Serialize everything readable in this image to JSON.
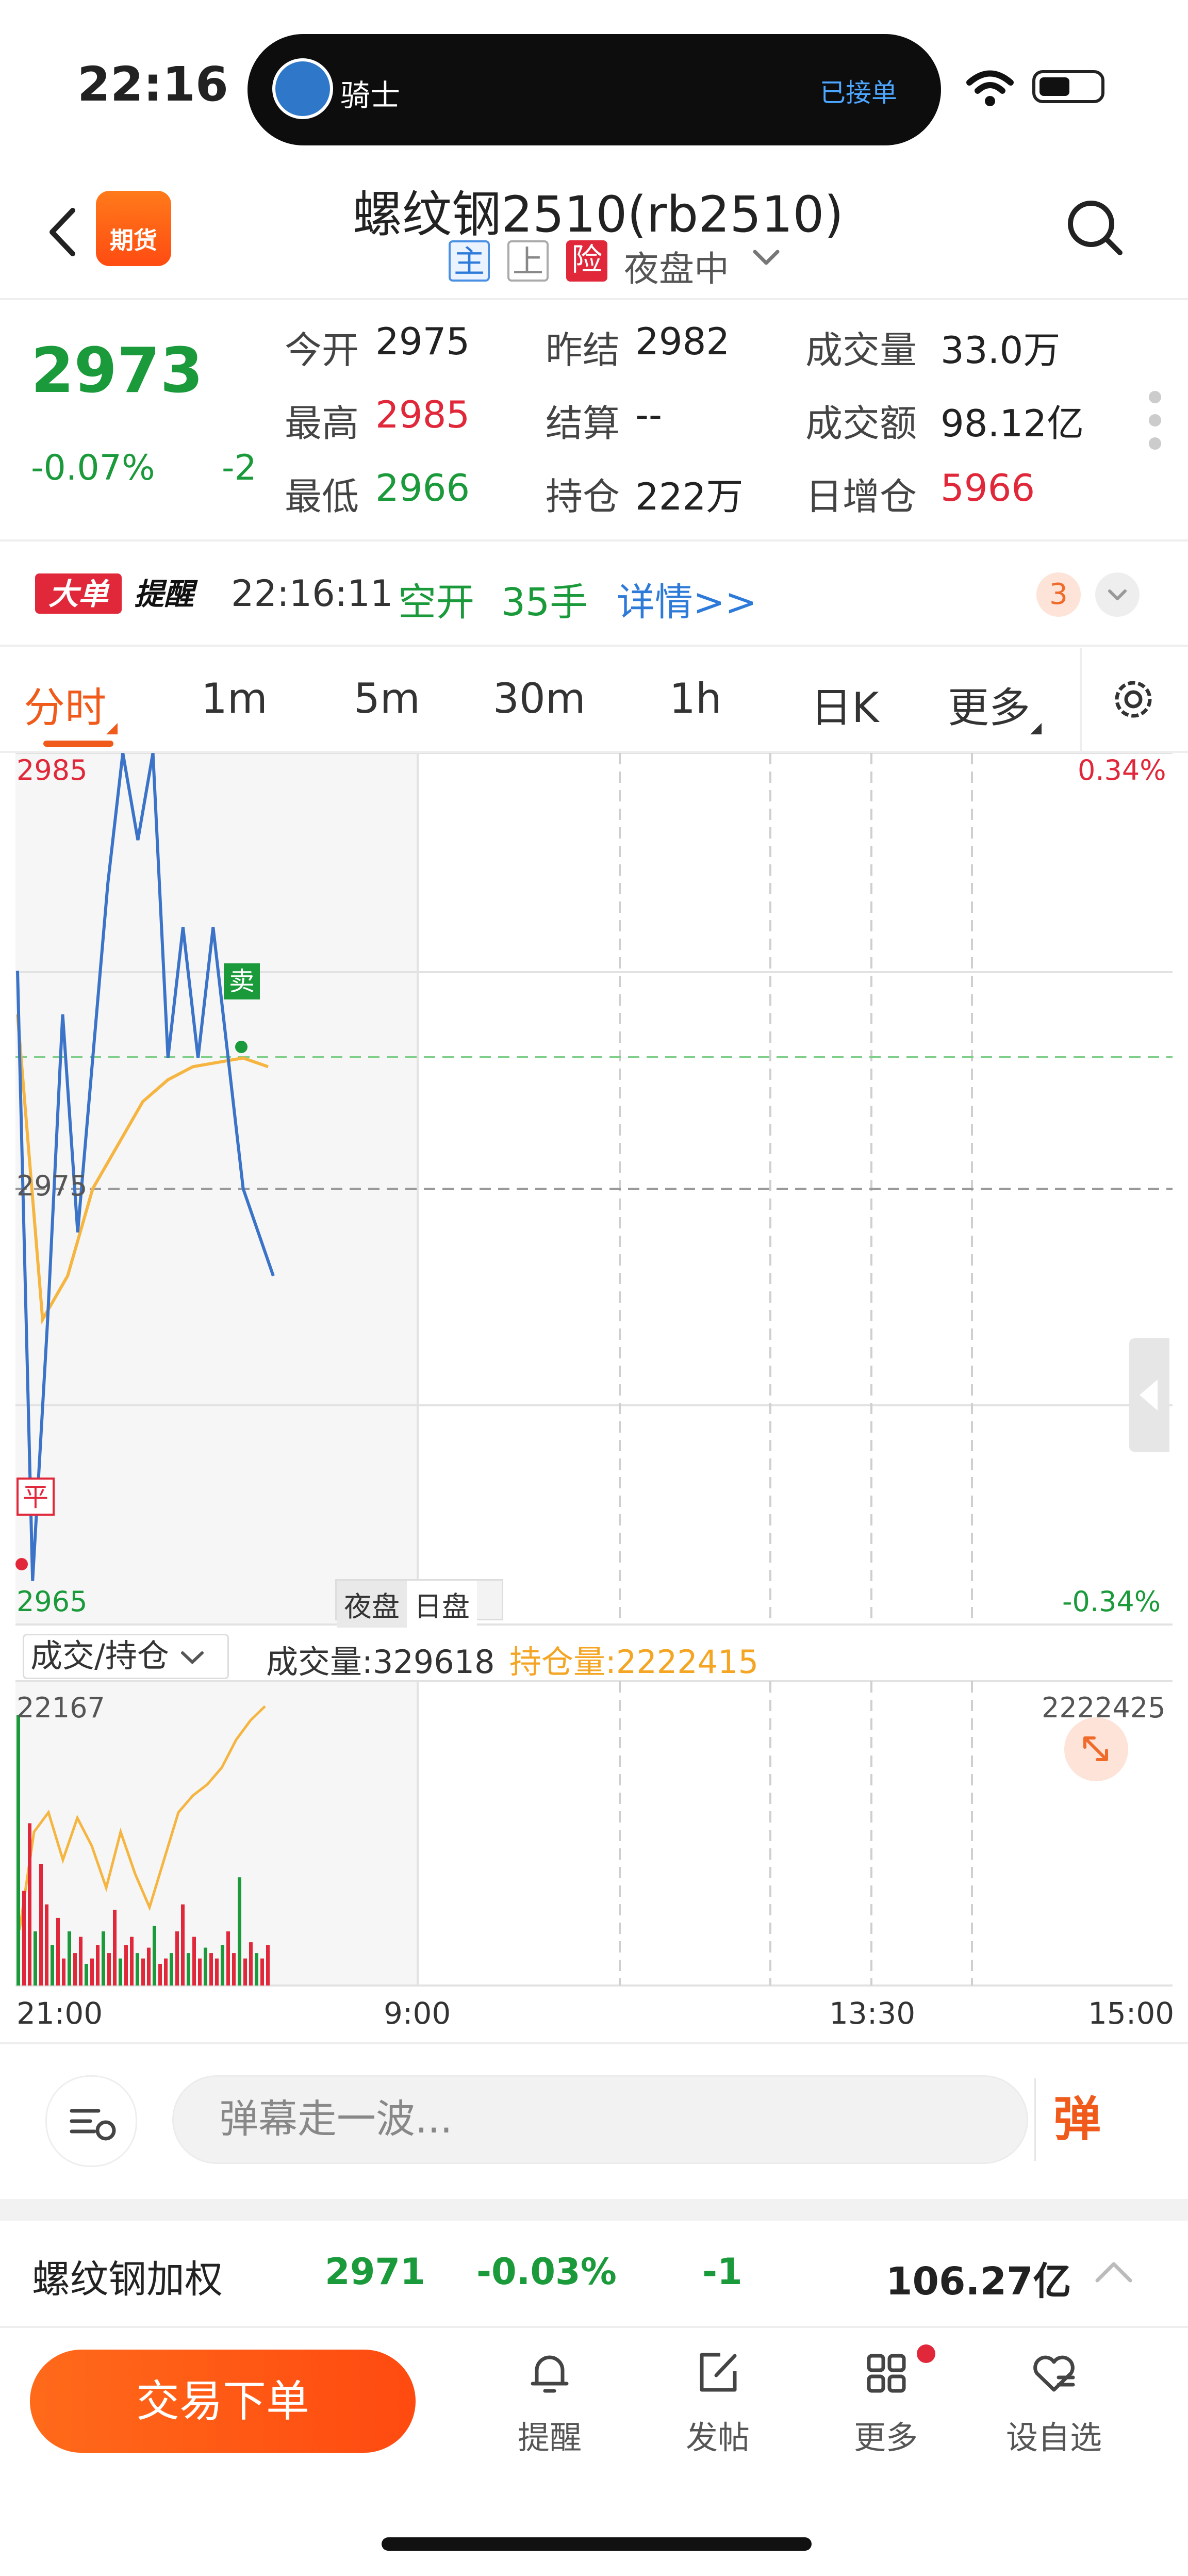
{
  "status_bar": {
    "time": "22:16",
    "activity_app": "骑士",
    "activity_status": "已接单"
  },
  "header": {
    "logo_text": "期货",
    "title": "螺纹钢2510(rb2510)",
    "tags": [
      "主",
      "上",
      "险"
    ],
    "session": "夜盘中"
  },
  "quote": {
    "last": "2973",
    "change_pct": "-0.07%",
    "change": "-2",
    "fields": [
      {
        "label": "今开",
        "value": "2975"
      },
      {
        "label": "昨结",
        "value": "2982"
      },
      {
        "label": "成交量",
        "value": "33.0万"
      },
      {
        "label": "最高",
        "value": "2985"
      },
      {
        "label": "结算",
        "value": "--"
      },
      {
        "label": "成交额",
        "value": "98.12亿"
      },
      {
        "label": "最低",
        "value": "2966"
      },
      {
        "label": "持仓",
        "value": "222万"
      },
      {
        "label": "日增仓",
        "value": "5966"
      }
    ]
  },
  "alert": {
    "logo": "大单提醒",
    "time": "22:16:11",
    "action": "空开",
    "qty": "35手",
    "detail": "详情>>",
    "count": "3"
  },
  "tabs": [
    "分时",
    "1m",
    "5m",
    "30m",
    "1h",
    "日K",
    "更多"
  ],
  "chart": {
    "y_top": "2985",
    "y_mid": "2975",
    "y_bottom": "2965",
    "pct_top": "0.34%",
    "pct_bottom": "-0.34%",
    "sell_marker": "卖",
    "flat_marker": "平",
    "session_toggle": [
      "夜盘",
      "日盘"
    ],
    "indicator": "成交/持仓",
    "volume_text": "成交量:329618",
    "oi_text": "持仓量:2222415",
    "vol_max": "22167",
    "oi_max": "2222425",
    "time_labels": [
      "21:00",
      "9:00",
      "13:30",
      "15:00"
    ],
    "colors": {
      "price": "#3a73c8",
      "avg": "#f5b540",
      "up": "#e0283a",
      "down": "#1a9a3a"
    }
  },
  "chart_data": {
    "type": "line",
    "ylim": [
      2965,
      2985
    ],
    "series": [
      {
        "values": [
          2980,
          2966,
          2972,
          2979,
          2974,
          2978,
          2982,
          2985,
          2983,
          2985,
          2978,
          2981,
          2978,
          2981,
          2978,
          2975,
          2974,
          2973
        ]
      },
      {
        "values": [
          2979,
          2972,
          2973,
          2975,
          2976,
          2977,
          2977.5,
          2977.8,
          2977.9,
          2978,
          2977.8
        ]
      }
    ]
  },
  "danmaku": {
    "placeholder": "弹幕走一波...",
    "send": "弹"
  },
  "weighted": {
    "name": "螺纹钢加权",
    "price": "2971",
    "pct": "-0.03%",
    "chg": "-1",
    "amount": "106.27亿"
  },
  "bottom": {
    "trade": "交易下单",
    "nav": [
      "提醒",
      "发帖",
      "更多",
      "设自选"
    ]
  }
}
